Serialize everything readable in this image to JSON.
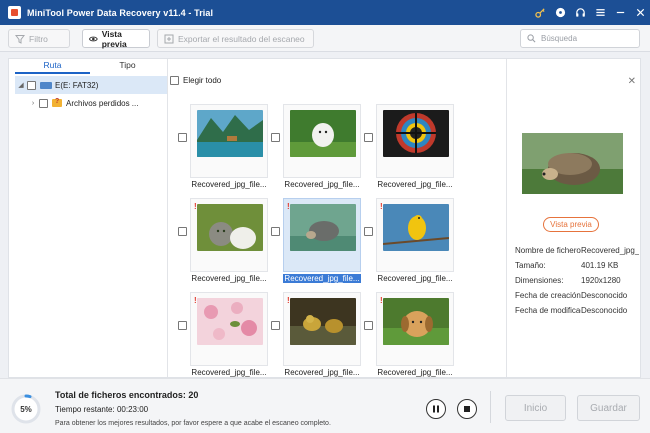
{
  "app": {
    "title": "MiniTool Power Data Recovery v11.4 - Trial",
    "title_icons": [
      "key-icon",
      "disc-icon",
      "headphones-icon",
      "menu-icon",
      "minimize-icon",
      "close-icon"
    ]
  },
  "toolbar": {
    "filter_label": "Filtro",
    "preview_label": "Vista previa",
    "export_label": "Exportar el resultado del escaneo",
    "search_placeholder": "Búsqueda"
  },
  "tabs": [
    "Ruta",
    "Tipo"
  ],
  "tree": {
    "drive": "E(E: FAT32)",
    "lost": "Archivos perdidos ..."
  },
  "grid": {
    "select_all": "Elegir todo",
    "files": [
      {
        "name": "Recovered_jpg_file...",
        "flag": false,
        "selected": false,
        "theme": "lake"
      },
      {
        "name": "Recovered_jpg_file...",
        "flag": false,
        "selected": false,
        "theme": "puppy"
      },
      {
        "name": "Recovered_jpg_file...",
        "flag": false,
        "selected": false,
        "theme": "lens"
      },
      {
        "name": "Recovered_jpg_file...",
        "flag": true,
        "selected": false,
        "theme": "cats"
      },
      {
        "name": "Recovered_jpg_file...",
        "flag": true,
        "selected": true,
        "theme": "hedgehog"
      },
      {
        "name": "Recovered_jpg_file...",
        "flag": true,
        "selected": false,
        "theme": "bird"
      },
      {
        "name": "Recovered_jpg_file...",
        "flag": true,
        "selected": false,
        "theme": "blossom"
      },
      {
        "name": "Recovered_jpg_file...",
        "flag": true,
        "selected": false,
        "theme": "duck"
      },
      {
        "name": "Recovered_jpg_file...",
        "flag": true,
        "selected": false,
        "theme": "dog"
      }
    ]
  },
  "preview": {
    "button_label": "Vista previa",
    "props": [
      {
        "key": "Nombre de fichero",
        "value": "Recovered_jpg_fi"
      },
      {
        "key": "Tamaño:",
        "value": "401.19 KB"
      },
      {
        "key": "Dimensiones:",
        "value": "1920x1280"
      },
      {
        "key": "Fecha de creación",
        "value": "Desconocido"
      },
      {
        "key": "Fecha de modificación",
        "value": "Desconocido"
      }
    ]
  },
  "status": {
    "progress_percent": 5,
    "progress_label": "5%",
    "found_label": "Total de ficheros encontrados:",
    "found_count": "20",
    "remaining_label": "Tiempo restante:",
    "remaining_time": "00:23:00",
    "hint": "Para obtener los mejores resultados, por favor espere a que acabe el escaneo completo.",
    "home_label": "Inicio",
    "save_label": "Guardar"
  },
  "colors": {
    "titlebar": "#1c4f95",
    "accent": "#1c63c6",
    "preview_button": "#e6733c",
    "flag": "#e23a2e"
  }
}
